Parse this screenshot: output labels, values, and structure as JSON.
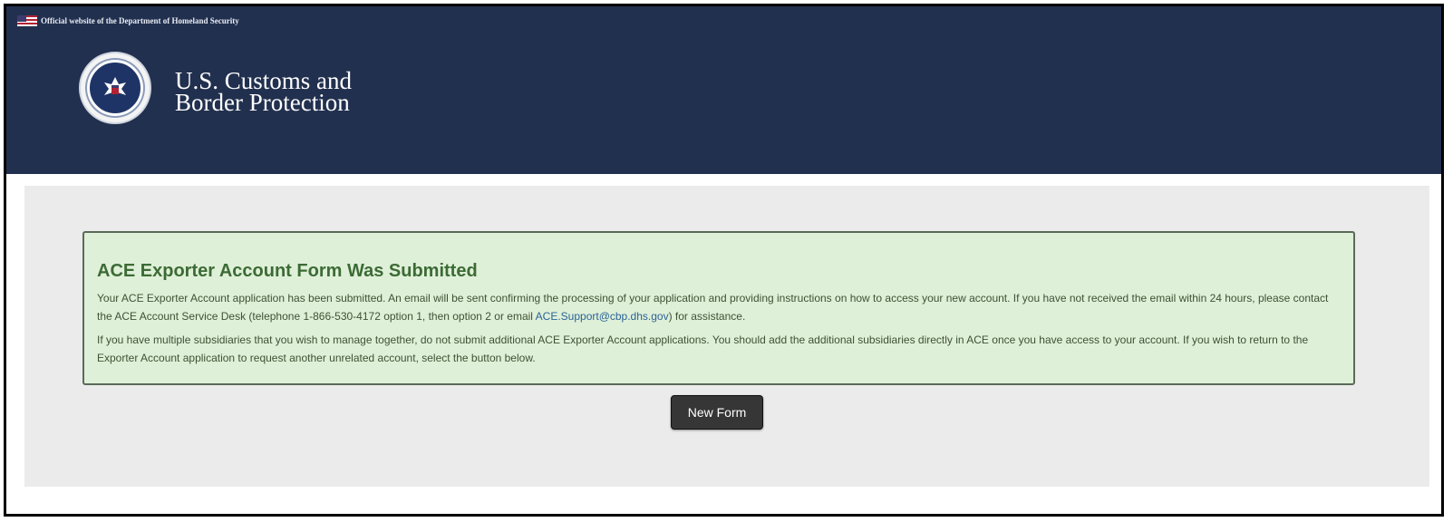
{
  "gov_banner": {
    "text": "Official website of the Department of Homeland Security",
    "flag_icon": "us-flag-icon"
  },
  "header": {
    "seal_icon": "dhs-seal-icon",
    "agency_line1": "U.S. Customs and",
    "agency_line2": "Border Protection"
  },
  "alert": {
    "title": "ACE Exporter Account Form Was Submitted",
    "para1_text": "Your ACE Exporter Account application has been submitted. An email will be sent confirming the processing of your application and providing instructions on how to access your new account. If you have not received the email within 24 hours, please contact the ACE Account Service Desk (telephone 1-866-530-4172 option 1, then option 2 or email ",
    "para1_link": "ACE.Support@cbp.dhs.gov",
    "para1_end": ") for assistance.",
    "para2": "If you have multiple subsidiaries that you wish to manage together, do not submit additional ACE Exporter Account applications. You should add the additional subsidiaries directly in ACE once you have access to your account. If you wish to return to the Exporter Account application to request another unrelated account, select the button below."
  },
  "actions": {
    "new_form_label": "New Form"
  },
  "colors": {
    "header_bg": "#22304f",
    "alert_bg": "#dff0d8",
    "alert_title": "#3c6b35",
    "button_bg": "#363636"
  }
}
